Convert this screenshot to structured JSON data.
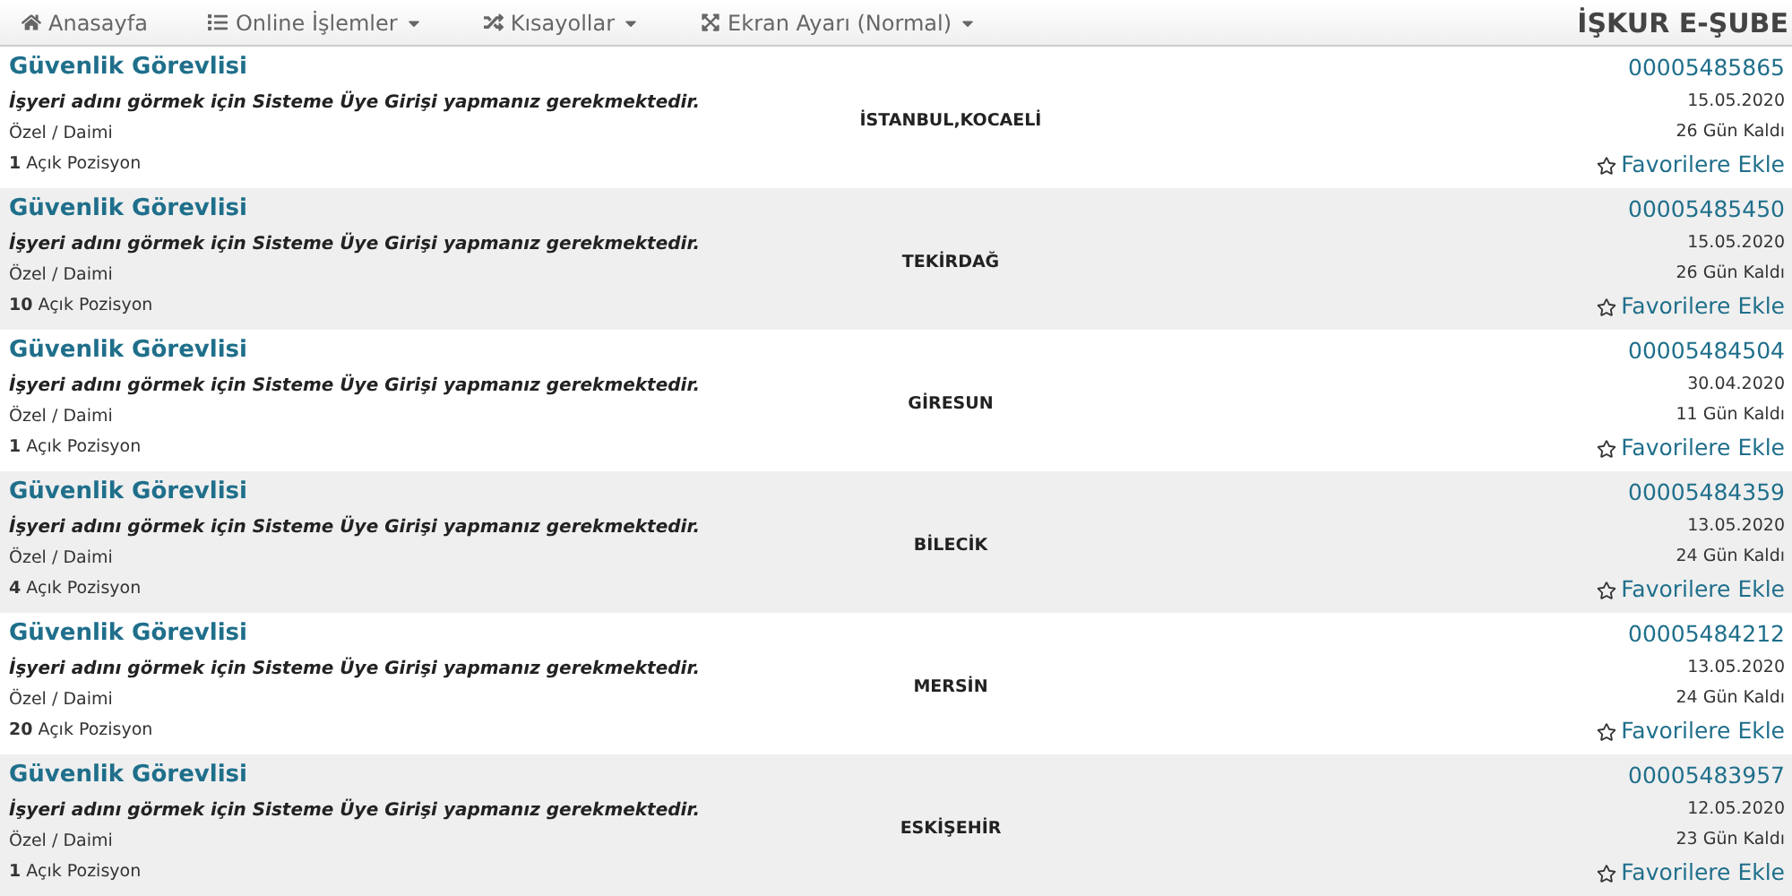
{
  "nav": {
    "items": [
      {
        "label": "Anasayfa",
        "dropdown": false
      },
      {
        "label": "Online İşlemler",
        "dropdown": true
      },
      {
        "label": "Kısayollar",
        "dropdown": true
      },
      {
        "label": "Ekran Ayarı (Normal)",
        "dropdown": true
      }
    ],
    "brand": "İŞKUR E-ŞUBE"
  },
  "listings": [
    {
      "title": "Güvenlik Görevlisi",
      "notice": "İşyeri adını görmek için Sisteme Üye Girişi yapmanız gerekmektedir.",
      "type": "Özel / Daimi",
      "positions": "**1** Açık Pozisyon",
      "city": "İSTANBUL,KOCAELİ",
      "number": "00005485865",
      "date": "15.05.2020",
      "remaining": "26 Gün Kaldı",
      "favorite": "Favorilere Ekle"
    },
    {
      "title": "Güvenlik Görevlisi",
      "notice": "İşyeri adını görmek için Sisteme Üye Girişi yapmanız gerekmektedir.",
      "type": "Özel / Daimi",
      "positions": "**10** Açık Pozisyon",
      "city": "TEKİRDAĞ",
      "number": "00005485450",
      "date": "15.05.2020",
      "remaining": "26 Gün Kaldı",
      "favorite": "Favorilere Ekle"
    },
    {
      "title": "Güvenlik Görevlisi",
      "notice": "İşyeri adını görmek için Sisteme Üye Girişi yapmanız gerekmektedir.",
      "type": "Özel / Daimi",
      "positions": "**1** Açık Pozisyon",
      "city": "GİRESUN",
      "number": "00005484504",
      "date": "30.04.2020",
      "remaining": "11 Gün Kaldı",
      "favorite": "Favorilere Ekle"
    },
    {
      "title": "Güvenlik Görevlisi",
      "notice": "İşyeri adını görmek için Sisteme Üye Girişi yapmanız gerekmektedir.",
      "type": "Özel / Daimi",
      "positions": "**4** Açık Pozisyon",
      "city": "BİLECİK",
      "number": "00005484359",
      "date": "13.05.2020",
      "remaining": "24 Gün Kaldı",
      "favorite": "Favorilere Ekle"
    },
    {
      "title": "Güvenlik Görevlisi",
      "notice": "İşyeri adını görmek için Sisteme Üye Girişi yapmanız gerekmektedir.",
      "type": "Özel / Daimi",
      "positions": "**20** Açık Pozisyon",
      "city": "MERSİN",
      "number": "00005484212",
      "date": "13.05.2020",
      "remaining": "24 Gün Kaldı",
      "favorite": "Favorilere Ekle"
    },
    {
      "title": "Güvenlik Görevlisi",
      "notice": "İşyeri adını görmek için Sisteme Üye Girişi yapmanız gerekmektedir.",
      "type": "Özel / Daimi",
      "positions": "**1** Açık Pozisyon",
      "city": "ESKİŞEHİR",
      "number": "00005483957",
      "date": "12.05.2020",
      "remaining": "23 Gün Kaldı",
      "favorite": "Favorilere Ekle"
    }
  ]
}
